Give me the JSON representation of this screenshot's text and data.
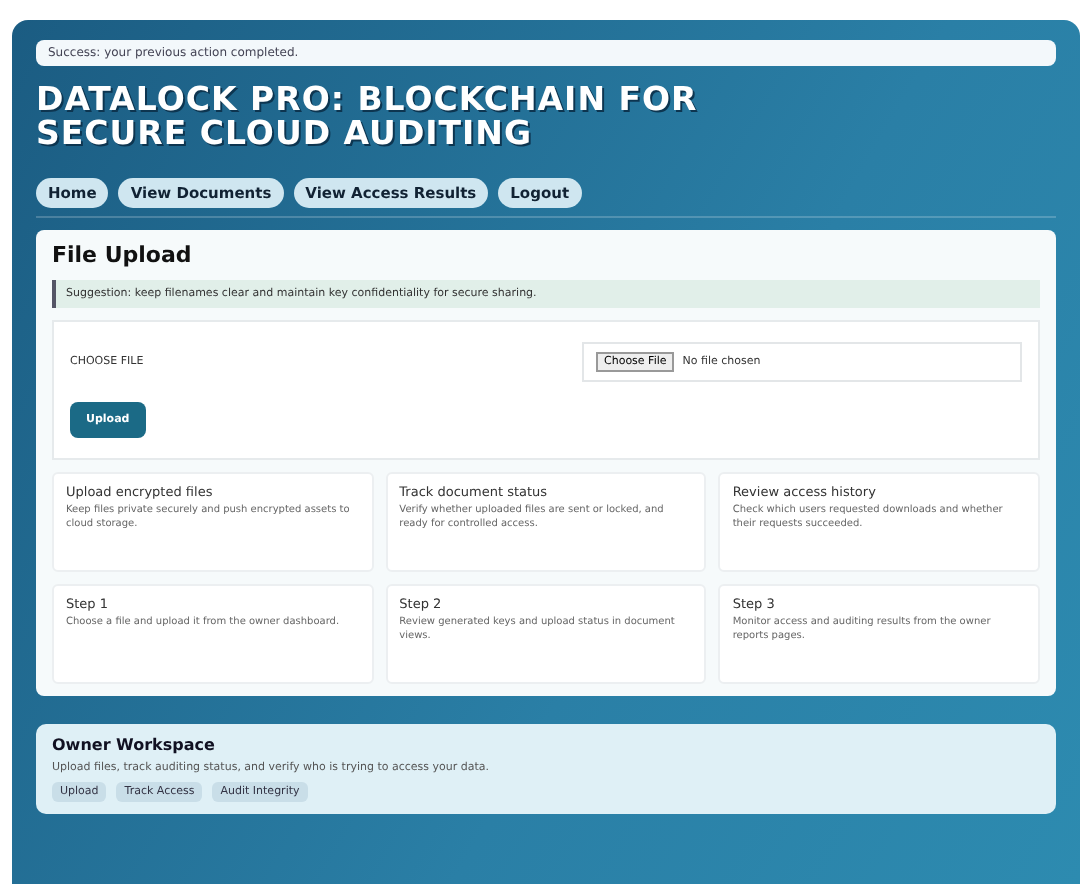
{
  "notice": "Success: your previous action completed.",
  "title": "DATALOCK PRO: BLOCKCHAIN FOR SECURE CLOUD AUDITING",
  "nav": [
    {
      "label": "Home"
    },
    {
      "label": "View Documents"
    },
    {
      "label": "View Access Results"
    },
    {
      "label": "Logout"
    }
  ],
  "upload": {
    "heading": "File Upload",
    "tip": "Suggestion: keep filenames clear and maintain key confidentiality for secure sharing.",
    "field_label": "CHOOSE FILE",
    "choose_button": "Choose File",
    "file_status": "No file chosen",
    "submit": "Upload"
  },
  "cards": [
    {
      "title": "Upload encrypted files",
      "text": "Keep files private securely and push encrypted assets to cloud storage."
    },
    {
      "title": "Track document status",
      "text": "Verify whether uploaded files are sent or locked, and ready for controlled access."
    },
    {
      "title": "Review access history",
      "text": "Check which users requested downloads and whether their requests succeeded."
    },
    {
      "title": "Step 1",
      "text": "Choose a file and upload it from the owner dashboard."
    },
    {
      "title": "Step 2",
      "text": "Review generated keys and upload status in document views."
    },
    {
      "title": "Step 3",
      "text": "Monitor access and auditing results from the owner reports pages."
    }
  ],
  "workspace": {
    "heading": "Owner Workspace",
    "text": "Upload files, track auditing status, and verify who is trying to access your data.",
    "tags": [
      "Upload",
      "Track Access",
      "Audit Integrity"
    ]
  }
}
